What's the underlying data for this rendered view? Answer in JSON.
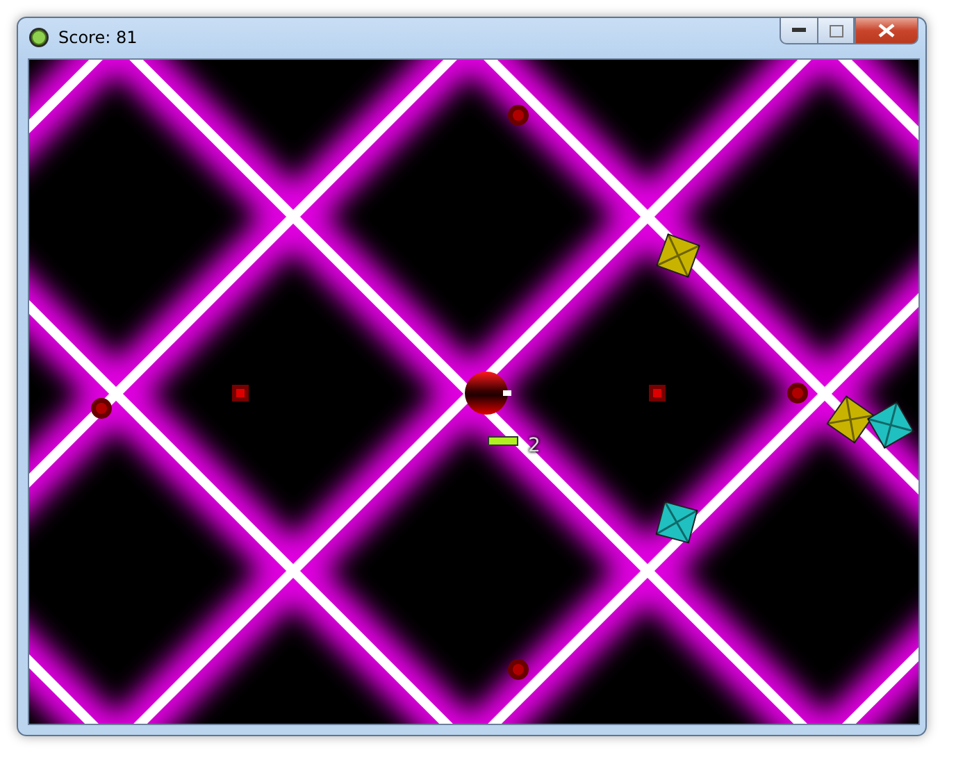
{
  "window": {
    "title": "Score: 81"
  },
  "player": {
    "health": {
      "level": 1
    },
    "counter": "2"
  },
  "entities": [
    {
      "kind": "mine"
    },
    {
      "kind": "mine"
    },
    {
      "kind": "mine"
    },
    {
      "kind": "mine"
    },
    {
      "kind": "spawner"
    },
    {
      "kind": "spawner"
    },
    {
      "kind": "cube",
      "color": "#c8b400"
    },
    {
      "kind": "cube",
      "color": "#c8b400"
    },
    {
      "kind": "cube",
      "color": "#20c0c0"
    },
    {
      "kind": "cube",
      "color": "#20c0c0"
    }
  ]
}
